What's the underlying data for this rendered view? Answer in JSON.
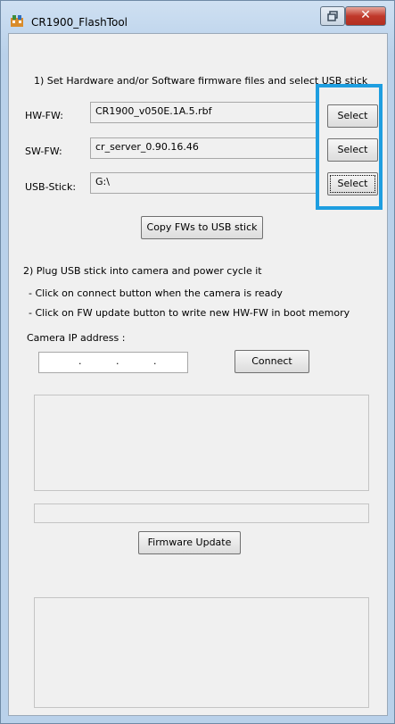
{
  "window": {
    "title": "CR1900_FlashTool"
  },
  "section1": {
    "heading": "1) Set Hardware and/or Software firmware files and select USB stick"
  },
  "hwfw": {
    "label": "HW-FW:",
    "value": "CR1900_v050E.1A.5.rbf",
    "button": "Select"
  },
  "swfw": {
    "label": "SW-FW:",
    "value": "cr_server_0.90.16.46",
    "button": "Select"
  },
  "usb": {
    "label": "USB-Stick:",
    "value": "G:\\",
    "button": "Select"
  },
  "copy_button": "Copy FWs to USB stick",
  "section2": {
    "heading": "2) Plug USB stick into camera and power cycle it",
    "note1": "- Click on connect button when the camera is ready",
    "note2": "- Click on FW update button to write new HW-FW in boot memory"
  },
  "camera_ip": {
    "label": "Camera IP address :",
    "dots": [
      ".",
      ".",
      "."
    ]
  },
  "connect_button": "Connect",
  "firmware_update_button": "Firmware Update",
  "icons": {
    "app": "app-icon",
    "restore": "restore-icon",
    "close": "close-icon"
  },
  "colors": {
    "highlight": "#1e9ee0",
    "close": "#c0392b"
  }
}
